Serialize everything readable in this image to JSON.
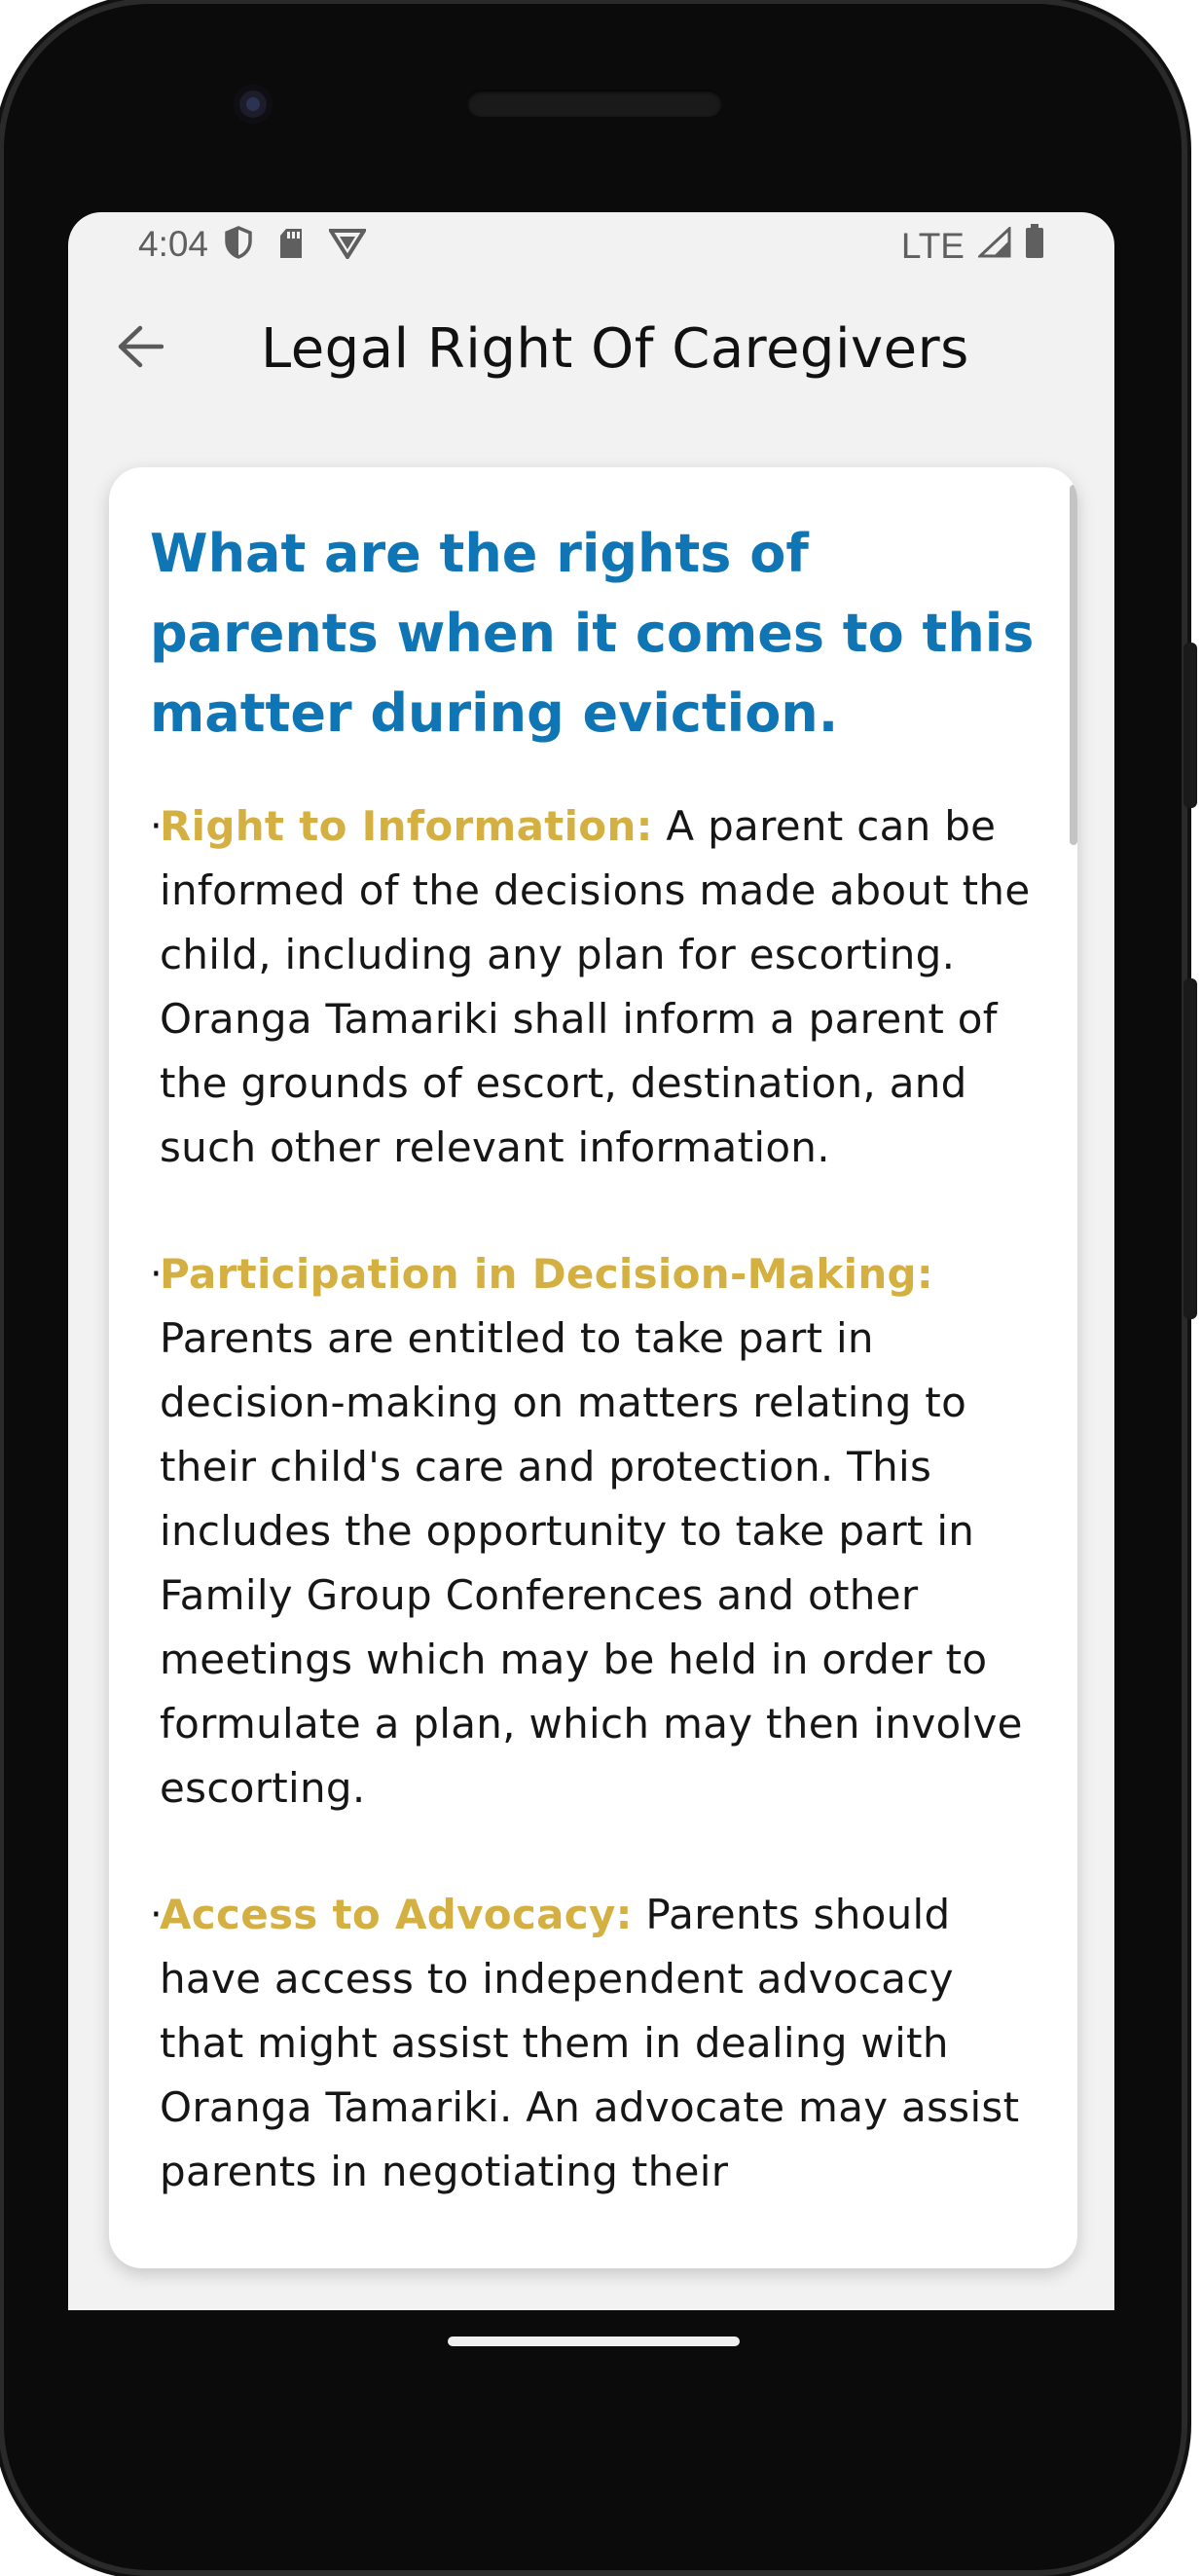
{
  "statusbar": {
    "time": "4:04",
    "network": "LTE",
    "icons_left": [
      "shield-icon",
      "sd-card-icon",
      "vpn-icon"
    ],
    "icons_right": [
      "signal-icon",
      "battery-icon"
    ]
  },
  "appbar": {
    "title": "Legal Right Of Caregivers",
    "back_icon": "arrow-back-icon"
  },
  "content": {
    "title": "What are the rights of parents when it comes to this matter during eviction.",
    "sections": [
      {
        "bullet": "·",
        "heading": "Right to Information:",
        "body": " A parent can be informed of the decisions made about the child, including any plan for escorting. Oranga Tamariki shall inform a parent of the grounds of escort, destination, and such other relevant information."
      },
      {
        "bullet": "·",
        "heading": "Participation in Decision-Making:",
        "body": " Parents are entitled to take part in decision-making on matters relating to their child's care and protection. This includes the opportunity to take part in Family Group Conferences and other meetings which may be held in order to formulate a plan, which may then involve escorting."
      },
      {
        "bullet": "·",
        "heading": "Access to Advocacy:",
        "body": " Parents should have access to independent advocacy that might assist them in dealing with Oranga Tamariki. An advocate may assist parents in negotiating their"
      }
    ]
  },
  "colors": {
    "title": "#0f75b4",
    "heading": "#d4b042",
    "background": "#f2f2f2"
  }
}
